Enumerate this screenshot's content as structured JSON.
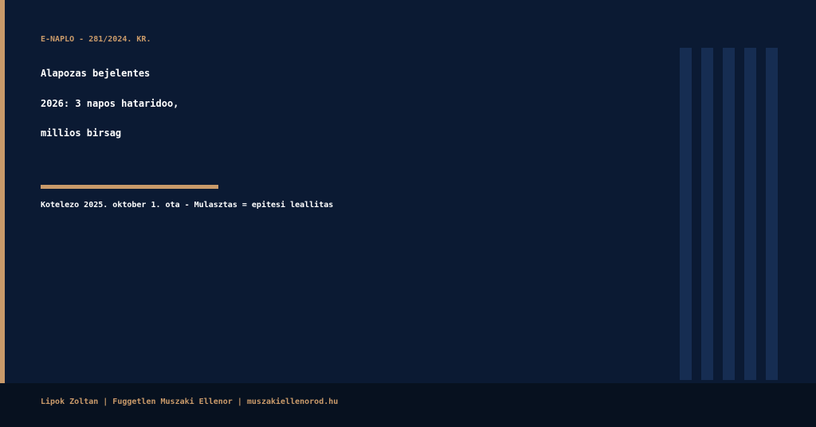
{
  "kicker": "E-NAPLO - 281/2024. KR.",
  "headline": {
    "line1": "Alapozas bejelentes",
    "line2": "2026: 3 napos hataridoo,",
    "line3": "millios birsag"
  },
  "subtext": "Kotelezo 2025. oktober 1. ota - Mulasztas = epitesi leallitas",
  "footer": {
    "text": "Lipok Zoltan | Fuggetlen Muszaki Ellenor | muszakiellenorod.hu"
  },
  "colors": {
    "background": "#0b1a33",
    "accent": "#c99a6a",
    "stripe": "#162d52",
    "footer_background": "#07111f",
    "headline_text": "#ffffff"
  }
}
